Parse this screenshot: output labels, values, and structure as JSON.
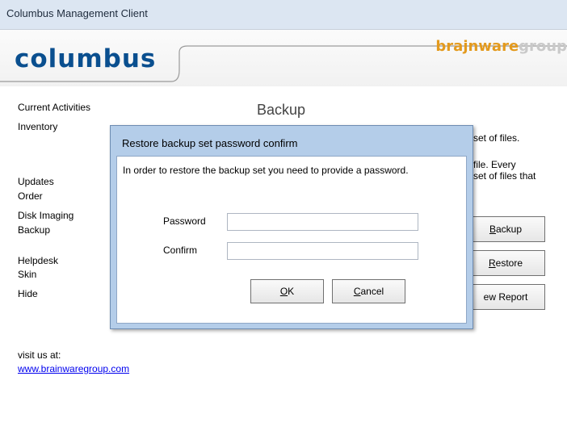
{
  "window": {
    "title": "Columbus Management Client"
  },
  "header": {
    "logo_text": "columbus",
    "brand_part1": "brajnware",
    "brand_part2": "group",
    "brand_color": "#e39a1e",
    "logo_color": "#0a4f8f"
  },
  "sidebar": {
    "items": [
      {
        "label": "Current Activities"
      },
      {
        "label": "Inventory"
      },
      {
        "label": "Updates"
      },
      {
        "label": "Order"
      },
      {
        "label": "Disk Imaging"
      },
      {
        "label": "Backup"
      },
      {
        "label": "Helpdesk"
      },
      {
        "label": "Skin"
      },
      {
        "label": "Hide"
      }
    ],
    "visit_text": "visit us at:",
    "visit_link": "www.brainwaregroup.com"
  },
  "main": {
    "section_title": "Backup",
    "desc_fragment_1": "set of files.",
    "desc_fragment_2": "file. Every",
    "desc_fragment_3": "set of files that",
    "backup_button": {
      "underlined": "B",
      "rest": "ackup"
    },
    "restore_button": {
      "underlined": "R",
      "rest": "estore"
    },
    "view_report_button": "ew Report"
  },
  "dialog": {
    "title": "Restore backup set password confirm",
    "message": "In order to restore the backup set you need to provide a password.",
    "password_label": "Password",
    "password_value": "",
    "confirm_label": "Confirm",
    "confirm_value": "",
    "ok_button": {
      "underlined": "O",
      "rest": "K"
    },
    "cancel_button": {
      "underlined": "C",
      "rest": "ancel"
    }
  }
}
